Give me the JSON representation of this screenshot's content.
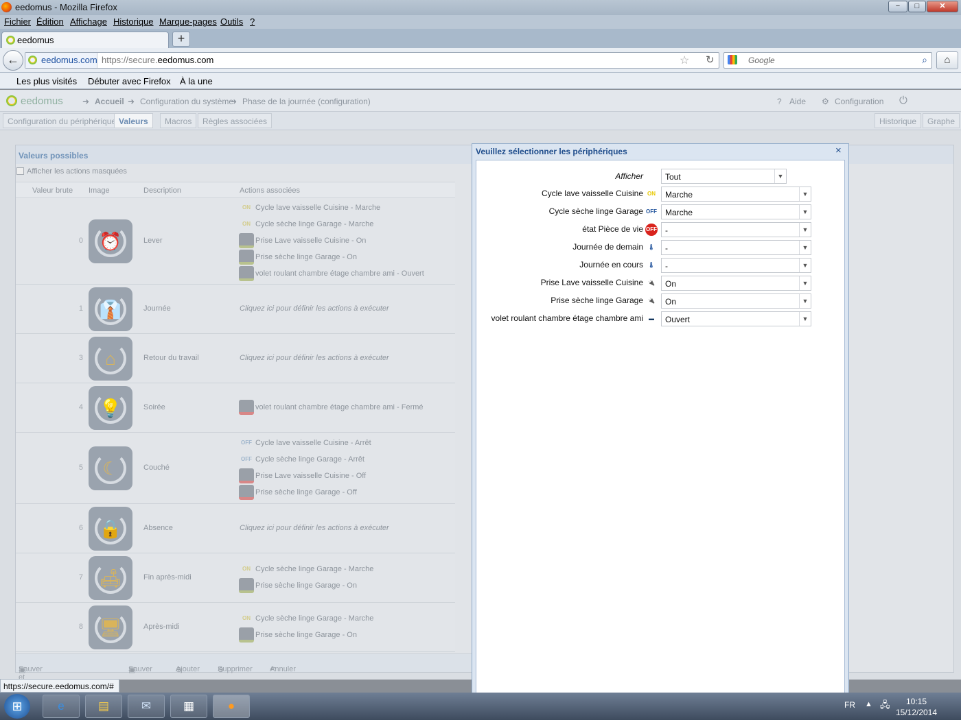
{
  "window": {
    "title": "eedomus - Mozilla Firefox",
    "min": "−",
    "max": "□",
    "close": "✕"
  },
  "menu": [
    "Fichier",
    "Édition",
    "Affichage",
    "Historique",
    "Marque-pages",
    "Outils",
    "?"
  ],
  "tab": {
    "label": "eedomus",
    "new": "+"
  },
  "nav": {
    "site": "eedomus.com",
    "url_prefix": "https://secure.",
    "url_domain": "eedomus.com",
    "search_placeholder": "Google",
    "back": "←",
    "home": "⌂"
  },
  "bookmarks": [
    "Les plus visités",
    "Débuter avec Firefox",
    "À la une"
  ],
  "app": {
    "brand": "eedomus",
    "breadcrumb": [
      "Accueil",
      "Configuration du système",
      "Phase de la journée (configuration)"
    ],
    "help": "Aide",
    "config": "Configuration",
    "tabs": [
      "Configuration du périphérique",
      "Valeurs",
      "Macros",
      "Règles associées"
    ],
    "right_tabs": [
      "Historique",
      "Graphe"
    ],
    "panel_title": "Valeurs possibles",
    "show_hidden": "Afficher les actions masquées",
    "columns": [
      "Valeur brute",
      "Image",
      "Description",
      "Actions associées"
    ],
    "empty_action": "Cliquez ici pour définir les actions à exécuter",
    "rows": [
      {
        "value": "0",
        "desc": "Lever",
        "icon": "alarm-clock-icon",
        "glyph": "⏰",
        "actions": [
          {
            "icon": "ON",
            "type": "on",
            "text": "Cycle lave vaisselle Cuisine - Marche"
          },
          {
            "icon": "ON",
            "type": "on",
            "text": "Cycle sèche linge Garage - Marche"
          },
          {
            "icon": "",
            "type": "dev",
            "text": "Prise Lave vaisselle Cuisine - On"
          },
          {
            "icon": "",
            "type": "dev",
            "text": "Prise sèche linge Garage - On"
          },
          {
            "icon": "",
            "type": "dev",
            "text": "volet roulant chambre étage chambre ami - Ouvert"
          }
        ]
      },
      {
        "value": "1",
        "desc": "Journée",
        "icon": "tie-icon",
        "glyph": "👔",
        "actions": []
      },
      {
        "value": "3",
        "desc": "Retour du travail",
        "icon": "house-icon",
        "glyph": "⌂",
        "actions": []
      },
      {
        "value": "4",
        "desc": "Soirée",
        "icon": "lamp-icon",
        "glyph": "💡",
        "actions": [
          {
            "icon": "",
            "type": "dev red",
            "text": "volet roulant chambre étage chambre ami - Fermé"
          }
        ]
      },
      {
        "value": "5",
        "desc": "Couché",
        "icon": "moon-icon",
        "glyph": "☾",
        "actions": [
          {
            "icon": "OFF",
            "type": "off",
            "text": "Cycle lave vaisselle Cuisine - Arrêt"
          },
          {
            "icon": "OFF",
            "type": "off",
            "text": "Cycle sèche linge Garage - Arrêt"
          },
          {
            "icon": "",
            "type": "dev red",
            "text": "Prise Lave vaisselle Cuisine - Off"
          },
          {
            "icon": "",
            "type": "dev red",
            "text": "Prise sèche linge Garage - Off"
          }
        ]
      },
      {
        "value": "6",
        "desc": "Absence",
        "icon": "padlock-house-icon",
        "glyph": "🔒",
        "actions": []
      },
      {
        "value": "7",
        "desc": "Fin après-midi",
        "icon": "sofa-icon",
        "glyph": "🛋",
        "actions": [
          {
            "icon": "ON",
            "type": "on",
            "text": "Cycle sèche linge Garage - Marche"
          },
          {
            "icon": "",
            "type": "dev",
            "text": "Prise sèche linge Garage - On"
          }
        ]
      },
      {
        "value": "8",
        "desc": "Après-midi",
        "icon": "monitor-icon",
        "glyph": "🖥",
        "actions": [
          {
            "icon": "ON",
            "type": "on",
            "text": "Cycle sèche linge Garage - Marche"
          },
          {
            "icon": "",
            "type": "dev",
            "text": "Prise sèche linge Garage - On"
          }
        ]
      }
    ],
    "footer": [
      "Sauver et continuer à éditer",
      "Sauver",
      "Ajouter",
      "Supprimer",
      "Annuler"
    ]
  },
  "dialog": {
    "title": "Veuillez sélectionner les périphériques",
    "close": "×",
    "show_label": "Afficher",
    "show_value": "Tout",
    "fields": [
      {
        "label": "Cycle lave vaisselle Cuisine",
        "icon": "ON",
        "color": "#e8c900",
        "value": "Marche"
      },
      {
        "label": "Cycle sèche linge Garage",
        "icon": "OFF",
        "color": "#2a5aa0",
        "value": "Marche"
      },
      {
        "label": "état Pièce de vie",
        "icon": "OFF",
        "color": "#d9231d",
        "value": "-"
      },
      {
        "label": "Journée de demain",
        "icon": "🌡",
        "color": "#2a5aa0",
        "value": "-"
      },
      {
        "label": "Journée en cours",
        "icon": "🌡",
        "color": "#2a5aa0",
        "value": "-"
      },
      {
        "label": "Prise Lave vaisselle Cuisine",
        "icon": "🔌",
        "color": "#7a8ea8",
        "value": "On"
      },
      {
        "label": "Prise sèche linge Garage",
        "icon": "🔌",
        "color": "#7a8ea8",
        "value": "On"
      },
      {
        "label": "volet roulant chambre étage chambre ami",
        "icon": "▬",
        "color": "#14365e",
        "value": "Ouvert"
      }
    ]
  },
  "status_url": "https://secure.eedomus.com/#",
  "taskbar": {
    "lang": "FR",
    "time": "10:15",
    "date": "15/12/2014"
  }
}
